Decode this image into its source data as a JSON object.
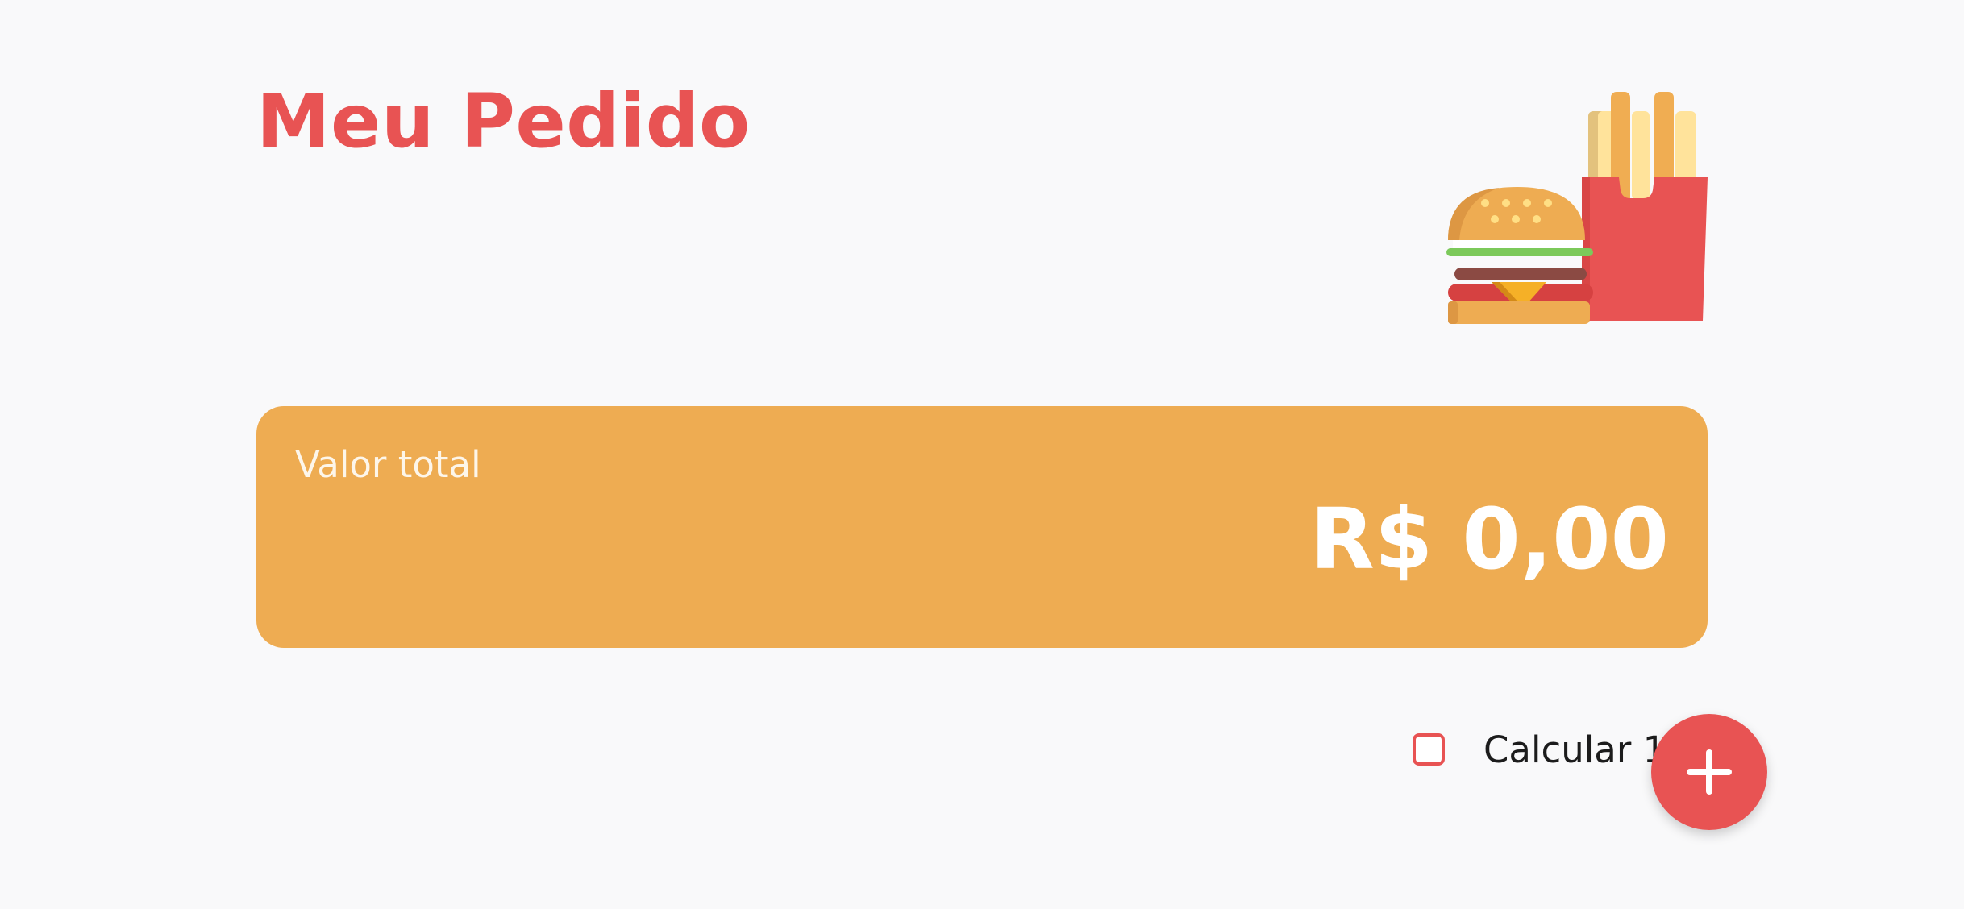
{
  "header": {
    "title": "Meu Pedido"
  },
  "illustration": {
    "icon": "burger-and-fries-icon"
  },
  "total": {
    "label": "Valor total",
    "value": "R$ 0,00"
  },
  "tip": {
    "checked": false,
    "label": "Calcular 10%"
  },
  "fab": {
    "icon": "plus-icon"
  },
  "colors": {
    "primary": "#e85353",
    "card": "#eeac52",
    "background": "#f9f9fa"
  }
}
